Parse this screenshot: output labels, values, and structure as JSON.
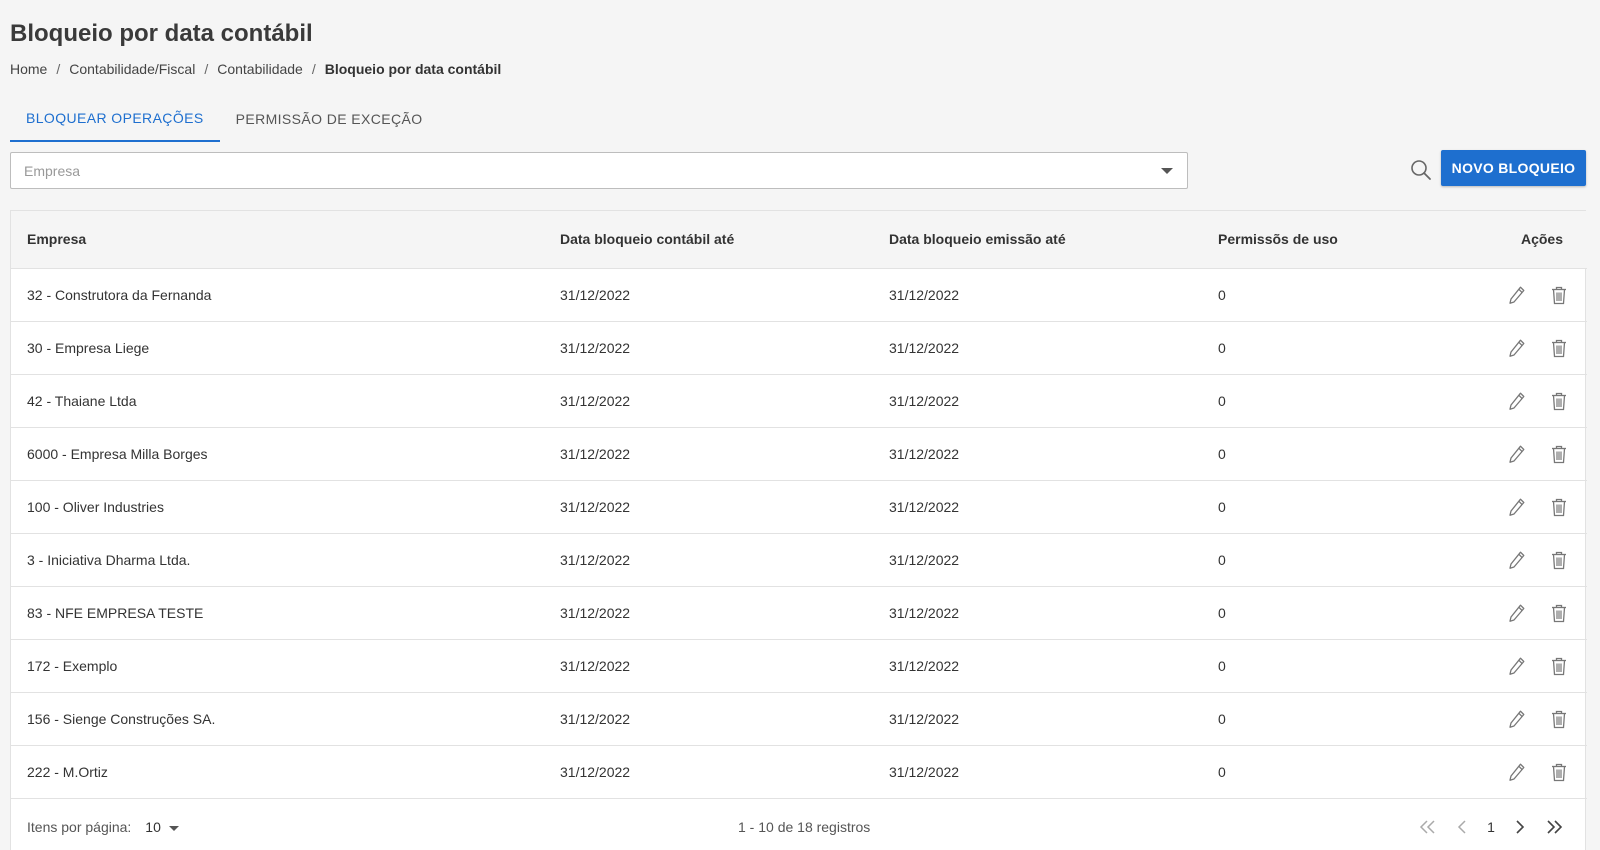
{
  "header": {
    "title": "Bloqueio por data contábil",
    "breadcrumb": [
      "Home",
      "Contabilidade/Fiscal",
      "Contabilidade"
    ],
    "breadcrumb_current": "Bloqueio por data contábil"
  },
  "tabs": [
    {
      "label": "BLOQUEAR OPERAÇÕES",
      "active": true
    },
    {
      "label": "PERMISSÃO DE EXCEÇÃO",
      "active": false
    }
  ],
  "filter": {
    "company_placeholder": "Empresa",
    "search_icon": "search-icon",
    "new_button_label": "NOVO BLOQUEIO"
  },
  "colors": {
    "accent": "#1e6fcf",
    "background": "#f5f5f5"
  },
  "table": {
    "columns": [
      "Empresa",
      "Data bloqueio contábil até",
      "Data bloqueio emissão até",
      "Permissõs de uso",
      "Ações"
    ],
    "rows": [
      {
        "empresa": "32 - Construtora da Fernanda",
        "data_contabil": "31/12/2022",
        "data_emissao": "31/12/2022",
        "permissoes": "0"
      },
      {
        "empresa": "30 - Empresa Liege",
        "data_contabil": "31/12/2022",
        "data_emissao": "31/12/2022",
        "permissoes": "0"
      },
      {
        "empresa": "42 - Thaiane Ltda",
        "data_contabil": "31/12/2022",
        "data_emissao": "31/12/2022",
        "permissoes": "0"
      },
      {
        "empresa": "6000 - Empresa Milla Borges",
        "data_contabil": "31/12/2022",
        "data_emissao": "31/12/2022",
        "permissoes": "0"
      },
      {
        "empresa": "100 - Oliver Industries",
        "data_contabil": "31/12/2022",
        "data_emissao": "31/12/2022",
        "permissoes": "0"
      },
      {
        "empresa": "3 - Iniciativa Dharma Ltda.",
        "data_contabil": "31/12/2022",
        "data_emissao": "31/12/2022",
        "permissoes": "0"
      },
      {
        "empresa": "83 - NFE EMPRESA TESTE",
        "data_contabil": "31/12/2022",
        "data_emissao": "31/12/2022",
        "permissoes": "0"
      },
      {
        "empresa": "172 - Exemplo",
        "data_contabil": "31/12/2022",
        "data_emissao": "31/12/2022",
        "permissoes": "0"
      },
      {
        "empresa": "156 - Sienge Construções SA.",
        "data_contabil": "31/12/2022",
        "data_emissao": "31/12/2022",
        "permissoes": "0"
      },
      {
        "empresa": "222 - M.Ortiz",
        "data_contabil": "31/12/2022",
        "data_emissao": "31/12/2022",
        "permissoes": "0"
      }
    ],
    "row_action_icons": [
      "pencil-icon",
      "trash-icon"
    ]
  },
  "pagination": {
    "items_per_page_label": "Itens por página:",
    "items_per_page": "10",
    "range_label": "1 - 10 de 18 registros",
    "current_page": "1"
  }
}
